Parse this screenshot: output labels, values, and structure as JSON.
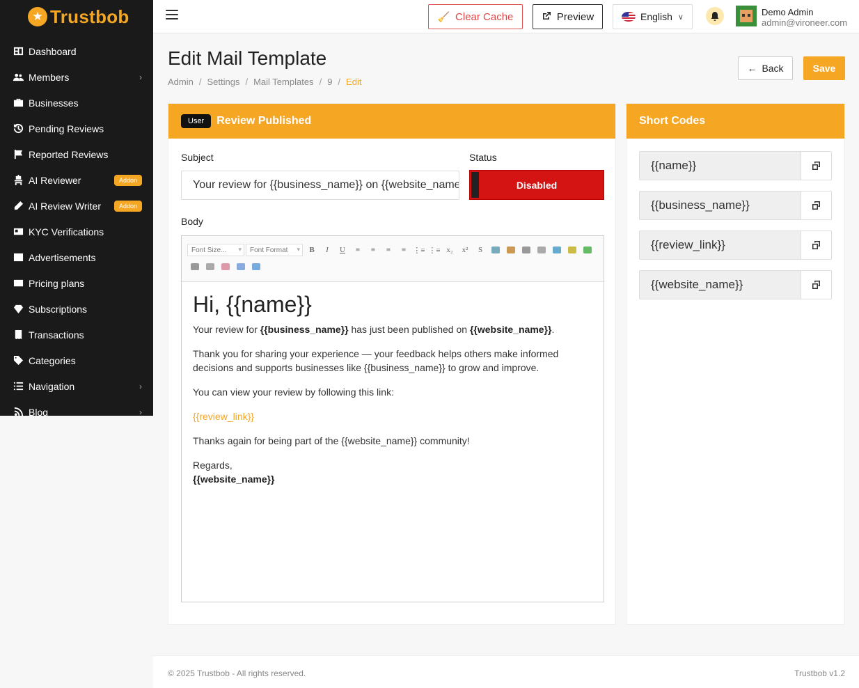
{
  "brand": {
    "name": "Trustbob",
    "accent": "#f5a623",
    "sidebar_bg": "#1a1a1a"
  },
  "sidebar": {
    "items": [
      {
        "label": "Dashboard",
        "icon": "dashboard-icon",
        "chevron": false,
        "addon": ""
      },
      {
        "label": "Members",
        "icon": "users-icon",
        "chevron": true,
        "addon": ""
      },
      {
        "label": "Businesses",
        "icon": "briefcase-icon",
        "chevron": false,
        "addon": ""
      },
      {
        "label": "Pending Reviews",
        "icon": "history-icon",
        "chevron": false,
        "addon": ""
      },
      {
        "label": "Reported Reviews",
        "icon": "flag-icon",
        "chevron": false,
        "addon": ""
      },
      {
        "label": "AI Reviewer",
        "icon": "robot-icon",
        "chevron": false,
        "addon": "Addon"
      },
      {
        "label": "AI Review Writer",
        "icon": "pen-icon",
        "chevron": false,
        "addon": "Addon"
      },
      {
        "label": "KYC Verifications",
        "icon": "id-card-icon",
        "chevron": false,
        "addon": ""
      },
      {
        "label": "Advertisements",
        "icon": "ad-icon",
        "chevron": false,
        "addon": ""
      },
      {
        "label": "Pricing plans",
        "icon": "pricing-icon",
        "chevron": false,
        "addon": ""
      },
      {
        "label": "Subscriptions",
        "icon": "gem-icon",
        "chevron": false,
        "addon": ""
      },
      {
        "label": "Transactions",
        "icon": "receipt-icon",
        "chevron": false,
        "addon": ""
      },
      {
        "label": "Categories",
        "icon": "tag-icon",
        "chevron": false,
        "addon": ""
      },
      {
        "label": "Navigation",
        "icon": "list-icon",
        "chevron": true,
        "addon": ""
      },
      {
        "label": "Blog",
        "icon": "rss-icon",
        "chevron": true,
        "addon": ""
      }
    ]
  },
  "topbar": {
    "clear_cache": "Clear Cache",
    "preview": "Preview",
    "language": "English",
    "user_name": "Demo Admin",
    "user_email": "admin@vironeer.com"
  },
  "page": {
    "title": "Edit Mail Template",
    "breadcrumbs": [
      "Admin",
      "Settings",
      "Mail Templates",
      "9",
      "Edit"
    ],
    "back": "Back",
    "save": "Save"
  },
  "template": {
    "badge": "User",
    "name": "Review Published",
    "subject_label": "Subject",
    "subject_value": "Your review for {{business_name}} on {{website_name}}",
    "status_label": "Status",
    "status_value": "Disabled",
    "body_label": "Body",
    "toolbar": {
      "font_size": "Font Size...",
      "font_format": "Font Format",
      "buttons": [
        "B",
        "I",
        "U",
        "≡",
        "≡",
        "≡",
        "≡",
        "⋮≡",
        "⋮≡",
        "x₂",
        "x²",
        "S"
      ]
    },
    "body": {
      "heading": "Hi, {{name}}",
      "p1_pre": "Your review for ",
      "p1_bold1": "{{business_name}}",
      "p1_mid": " has just been published on ",
      "p1_bold2": "{{website_name}}",
      "p1_end": ".",
      "p2": "Thank you for sharing your experience — your feedback helps others make informed decisions and supports businesses like {{business_name}} to grow and improve.",
      "p3": "You can view your review by following this link:",
      "link": "{{review_link}}",
      "p4": "Thanks again for being part of the {{website_name}} community!",
      "regards": "Regards,",
      "signature": "{{website_name}}"
    }
  },
  "short_codes": {
    "title": "Short Codes",
    "items": [
      "{{name}}",
      "{{business_name}}",
      "{{review_link}}",
      "{{website_name}}"
    ]
  },
  "footer": {
    "copyright": "© 2025 Trustbob - All rights reserved.",
    "version": "Trustbob v1.2"
  }
}
